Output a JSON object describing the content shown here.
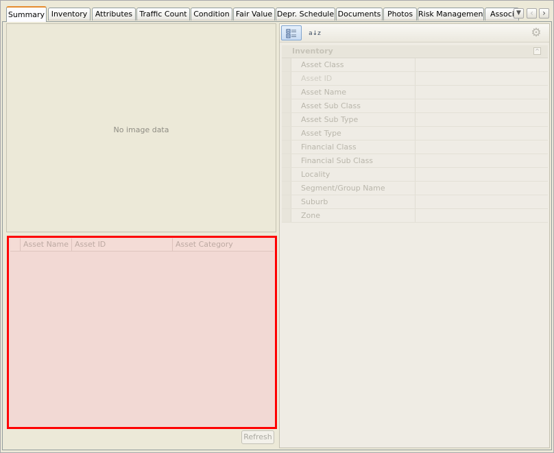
{
  "tabs": [
    {
      "label": "Summary",
      "active": true
    },
    {
      "label": "Inventory"
    },
    {
      "label": "Attributes"
    },
    {
      "label": "Traffic Count"
    },
    {
      "label": "Condition"
    },
    {
      "label": "Fair Value"
    },
    {
      "label": "Depr. Schedule"
    },
    {
      "label": "Documents"
    },
    {
      "label": "Photos"
    },
    {
      "label": "Risk Management"
    },
    {
      "label": "Associ"
    }
  ],
  "tab_nav": {
    "dropdown": "▼",
    "prev": "‹",
    "next": "›"
  },
  "image_panel": {
    "placeholder": "No image data"
  },
  "grid": {
    "columns": [
      "Asset Name",
      "Asset ID",
      "Asset Category"
    ],
    "rows": []
  },
  "refresh_button": "Refresh",
  "toolbar": {
    "categorized_icon": "categorized-view-icon",
    "alpha_icon": "alphabetical-sort-icon",
    "alpha_label": "a↓z",
    "settings_icon": "gear-icon",
    "gear_glyph": "⚙"
  },
  "property_grid": {
    "category": "Inventory",
    "collapse_glyph": "^",
    "properties": [
      {
        "name": "Asset Class",
        "value": ""
      },
      {
        "name": "Asset ID",
        "value": "",
        "dim": true
      },
      {
        "name": "Asset Name",
        "value": ""
      },
      {
        "name": "Asset Sub Class",
        "value": ""
      },
      {
        "name": "Asset Sub Type",
        "value": ""
      },
      {
        "name": "Asset Type",
        "value": ""
      },
      {
        "name": "Financial Class",
        "value": ""
      },
      {
        "name": "Financial Sub Class",
        "value": ""
      },
      {
        "name": "Locality",
        "value": ""
      },
      {
        "name": "Segment/Group Name",
        "value": ""
      },
      {
        "name": "Suburb",
        "value": ""
      },
      {
        "name": "Zone",
        "value": ""
      }
    ]
  },
  "colors": {
    "selection_border": "#ff0000",
    "selection_fill": "#f2d9d4",
    "active_tab_accent": "#e68b2c"
  }
}
